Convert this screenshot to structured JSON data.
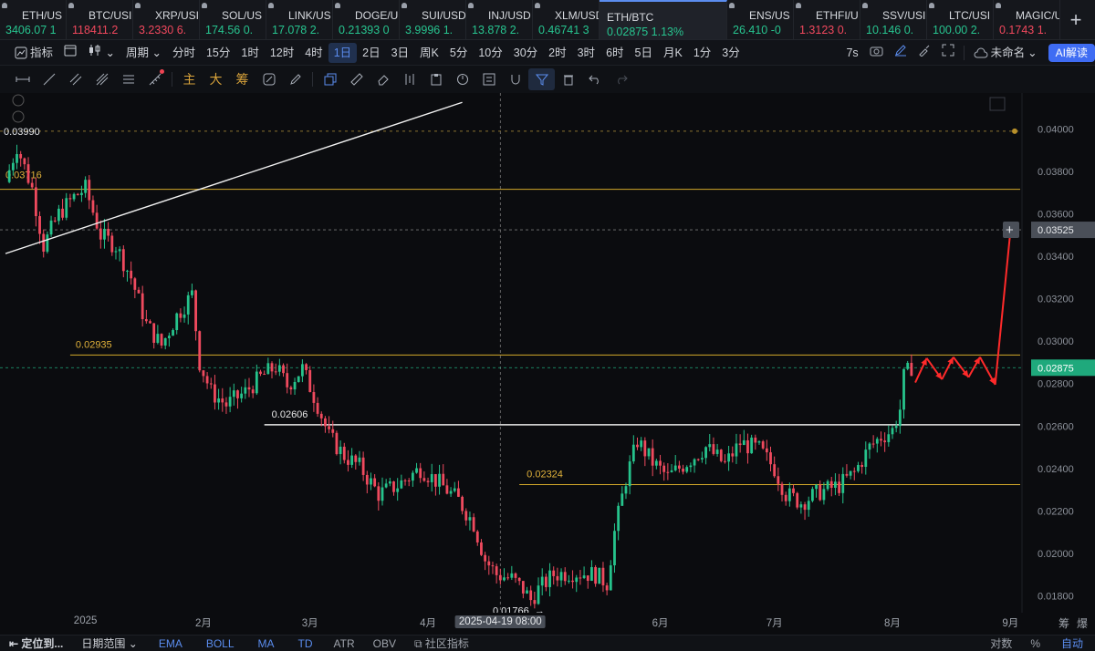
{
  "tickers": [
    {
      "symbol": "ETH/US",
      "price": "3406.07",
      "change": "1",
      "dir": "up"
    },
    {
      "symbol": "BTC/USI",
      "price": "118411.2",
      "change": "",
      "dir": "down"
    },
    {
      "symbol": "XRP/USI",
      "price": "3.2330",
      "change": "6.",
      "dir": "down"
    },
    {
      "symbol": "SOL/US",
      "price": "174.56",
      "change": "0.",
      "dir": "up"
    },
    {
      "symbol": "LINK/US",
      "price": "17.078",
      "change": "2.",
      "dir": "up"
    },
    {
      "symbol": "DOGE/U",
      "price": "0.21393",
      "change": "0",
      "dir": "up"
    },
    {
      "symbol": "SUI/USD",
      "price": "3.9996",
      "change": "1.",
      "dir": "up"
    },
    {
      "symbol": "INJ/USD",
      "price": "13.878",
      "change": "2.",
      "dir": "up"
    },
    {
      "symbol": "XLM/USD",
      "price": "0.46741",
      "change": "3",
      "dir": "up"
    },
    {
      "symbol": "ETH/BTC",
      "price": "0.02875",
      "change": "1.13%",
      "dir": "up",
      "active": true
    },
    {
      "symbol": "ENS/US",
      "price": "26.410",
      "change": "-0",
      "dir": "up"
    },
    {
      "symbol": "ETHFI/U",
      "price": "1.3123",
      "change": "0.",
      "dir": "down"
    },
    {
      "symbol": "SSV/USI",
      "price": "10.146",
      "change": "0.",
      "dir": "up"
    },
    {
      "symbol": "LTC/USI",
      "price": "100.00",
      "change": "2.",
      "dir": "up"
    },
    {
      "symbol": "MAGIC/U",
      "price": "0.1743",
      "change": "1.",
      "dir": "down"
    }
  ],
  "toolbar": {
    "indicators_label": "指标",
    "period_label": "周期",
    "timeframes": [
      "分时",
      "15分",
      "1时",
      "12时",
      "4时",
      "1日",
      "2日",
      "3日",
      "周K",
      "5分",
      "10分",
      "30分",
      "2时",
      "3时",
      "6时",
      "5日",
      "月K",
      "1分",
      "3分"
    ],
    "active_timeframe": "1日",
    "countdown": "7s",
    "layout_name": "未命名",
    "ai_label": "AI解读"
  },
  "drawing_tools": {
    "main_label": "主",
    "big_label": "大",
    "chip_label": "筹"
  },
  "chart_data": {
    "type": "candlestick",
    "pair": "ETH/BTC",
    "y_ticks": [
      "0.04000",
      "0.03800",
      "0.03600",
      "0.03400",
      "0.03200",
      "0.03000",
      "0.02800",
      "0.02600",
      "0.02400",
      "0.02200",
      "0.02000",
      "0.01800"
    ],
    "ylim": [
      0.0172,
      0.0417
    ],
    "x_ticks": [
      {
        "label": "2025",
        "day": 0
      },
      {
        "label": "2月",
        "day": 31
      },
      {
        "label": "3月",
        "day": 59
      },
      {
        "label": "4月",
        "day": 90
      },
      {
        "label": "6月",
        "day": 151
      },
      {
        "label": "7月",
        "day": 181
      },
      {
        "label": "8月",
        "day": 212
      },
      {
        "label": "9月",
        "day": 243
      }
    ],
    "cursor_time": "2025-04-19 08:00",
    "current_price": "0.02875",
    "crosshair_price": "0.03525",
    "levels": [
      {
        "label": "0.03990",
        "price": 0.0399,
        "style": "dashed-gold"
      },
      {
        "label": "0.03716",
        "price": 0.03716,
        "style": "gold"
      },
      {
        "label": "0.02935",
        "price": 0.02935,
        "style": "gold"
      },
      {
        "label": "0.02606",
        "price": 0.02606,
        "style": "white"
      },
      {
        "label": "0.02324",
        "price": 0.02324,
        "style": "gold"
      }
    ],
    "low_label": "0.01766",
    "price_path": [
      [
        -21,
        0.0375
      ],
      [
        -18,
        0.0392
      ],
      [
        -14,
        0.0372
      ],
      [
        -11,
        0.0345
      ],
      [
        -7,
        0.036
      ],
      [
        -3,
        0.0368
      ],
      [
        0,
        0.0372
      ],
      [
        4,
        0.035
      ],
      [
        8,
        0.0345
      ],
      [
        12,
        0.033
      ],
      [
        16,
        0.0308
      ],
      [
        20,
        0.0298
      ],
      [
        24,
        0.0312
      ],
      [
        28,
        0.0322
      ],
      [
        30,
        0.029
      ],
      [
        33,
        0.0276
      ],
      [
        37,
        0.027
      ],
      [
        42,
        0.0276
      ],
      [
        46,
        0.0283
      ],
      [
        50,
        0.0288
      ],
      [
        53,
        0.0279
      ],
      [
        57,
        0.0287
      ],
      [
        61,
        0.027
      ],
      [
        64,
        0.0255
      ],
      [
        68,
        0.0246
      ],
      [
        72,
        0.0241
      ],
      [
        77,
        0.0228
      ],
      [
        82,
        0.0232
      ],
      [
        88,
        0.024
      ],
      [
        93,
        0.0233
      ],
      [
        98,
        0.0225
      ],
      [
        102,
        0.0214
      ],
      [
        105,
        0.0197
      ],
      [
        108,
        0.019
      ],
      [
        112,
        0.0188
      ],
      [
        115,
        0.0183
      ],
      [
        117,
        0.0178
      ],
      [
        119,
        0.0183
      ],
      [
        123,
        0.019
      ],
      [
        128,
        0.0191
      ],
      [
        134,
        0.019
      ],
      [
        137,
        0.0186
      ],
      [
        139,
        0.021
      ],
      [
        142,
        0.0235
      ],
      [
        145,
        0.0253
      ],
      [
        149,
        0.0243
      ],
      [
        153,
        0.0236
      ],
      [
        158,
        0.0243
      ],
      [
        163,
        0.025
      ],
      [
        168,
        0.0242
      ],
      [
        172,
        0.0252
      ],
      [
        177,
        0.0249
      ],
      [
        181,
        0.024
      ],
      [
        184,
        0.0228
      ],
      [
        188,
        0.0224
      ],
      [
        193,
        0.0229
      ],
      [
        198,
        0.0232
      ],
      [
        202,
        0.0238
      ],
      [
        206,
        0.025
      ],
      [
        209,
        0.0255
      ],
      [
        212,
        0.0258
      ],
      [
        214,
        0.0268
      ],
      [
        215,
        0.0283
      ],
      [
        217,
        0.0288
      ]
    ],
    "trendline": [
      [
        -21,
        0.03413
      ],
      [
        99,
        0.04126
      ]
    ],
    "forecast_path": [
      [
        218,
        0.02805
      ],
      [
        221,
        0.0292
      ],
      [
        225,
        0.0282
      ],
      [
        228,
        0.02925
      ],
      [
        232,
        0.0283
      ],
      [
        235,
        0.02925
      ],
      [
        239,
        0.02795
      ],
      [
        243,
        0.0352
      ]
    ],
    "last_day": 217
  },
  "bottom_bar": {
    "locate_label": "定位到...",
    "date_range_label": "日期范围",
    "indicators": [
      "EMA",
      "BOLL",
      "MA",
      "TD",
      "ATR",
      "OBV"
    ],
    "community_label": "社区指标",
    "right_labels": [
      "对数",
      "%",
      "自动"
    ],
    "corner_labels": [
      "筹",
      "爆"
    ]
  }
}
